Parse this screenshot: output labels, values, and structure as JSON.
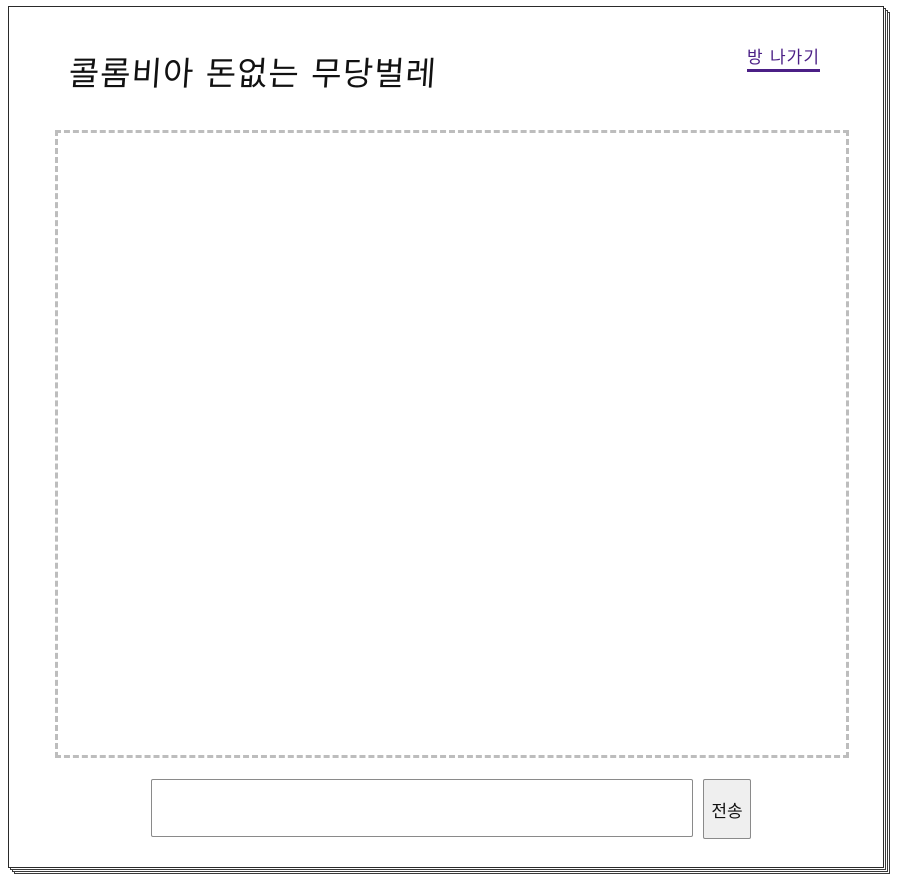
{
  "header": {
    "title": "콜롬비아 돈없는 무당벌레",
    "leave_label": "방 나가기"
  },
  "chat": {
    "messages": []
  },
  "composer": {
    "input_value": "",
    "input_placeholder": "",
    "send_label": "전송"
  },
  "colors": {
    "link": "#4b1f86",
    "chat_border": "#bdbdbd",
    "button_bg": "#efefef"
  }
}
